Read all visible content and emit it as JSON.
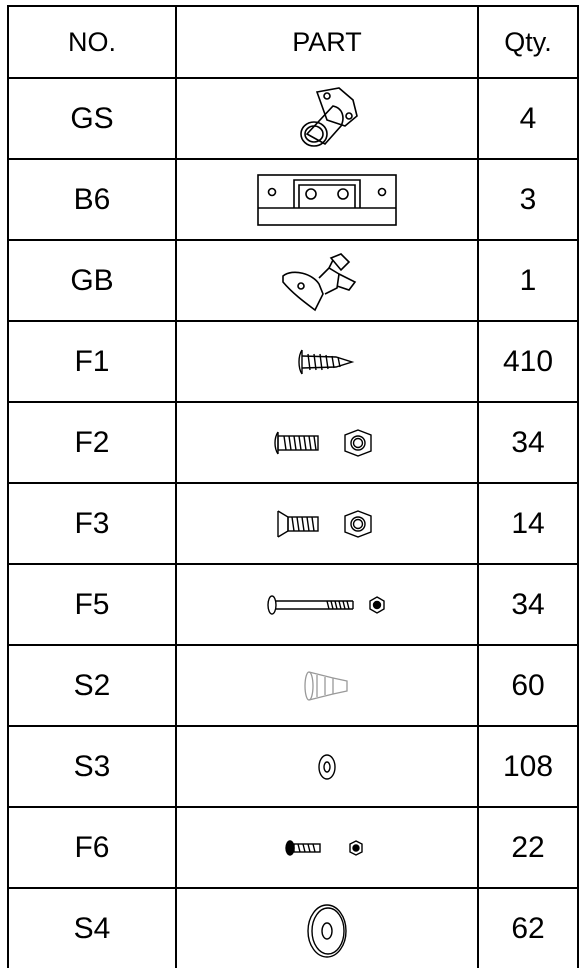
{
  "headers": {
    "no": "NO.",
    "part": "PART",
    "qty": "Qty."
  },
  "rows": [
    {
      "no": "GS",
      "qty": "4",
      "icon": "gs-flange-icon"
    },
    {
      "no": "B6",
      "qty": "3",
      "icon": "b6-bracket-icon"
    },
    {
      "no": "GB",
      "qty": "1",
      "icon": "gb-latch-icon"
    },
    {
      "no": "F1",
      "qty": "410",
      "icon": "f1-screw-icon"
    },
    {
      "no": "F2",
      "qty": "34",
      "icon": "f2-bolt-nut-icon"
    },
    {
      "no": "F3",
      "qty": "14",
      "icon": "f3-countersunk-bolt-nut-icon"
    },
    {
      "no": "F5",
      "qty": "34",
      "icon": "f5-long-bolt-nut-icon"
    },
    {
      "no": "S2",
      "qty": "60",
      "icon": "s2-plug-icon"
    },
    {
      "no": "S3",
      "qty": "108",
      "icon": "s3-washer-icon"
    },
    {
      "no": "F6",
      "qty": "22",
      "icon": "f6-small-bolt-nut-icon"
    },
    {
      "no": "S4",
      "qty": "62",
      "icon": "s4-large-washer-icon"
    }
  ],
  "colors": {
    "line": "#000000",
    "background": "#ffffff"
  }
}
